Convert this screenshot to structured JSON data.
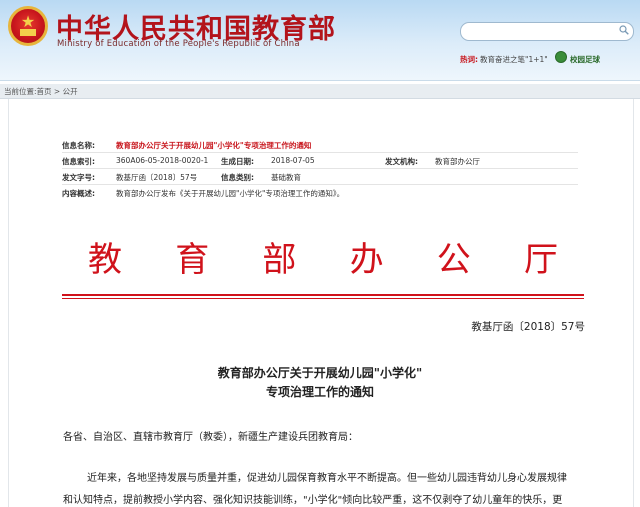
{
  "header": {
    "site_title": "中华人民共和国教育部",
    "site_subtitle": "Ministry of Education of the People's Republic of China",
    "hot_label": "热词:",
    "hot_link": "教育奋进之笔\"1+1\"",
    "campus_link": "校园足球"
  },
  "breadcrumb": {
    "prefix": "当前位置:",
    "home": "首页",
    "sep": " > ",
    "current": "公开"
  },
  "info": {
    "name_label": "信息名称:",
    "name_value": "教育部办公厅关于开展幼儿园\"小学化\"专项治理工作的通知",
    "index_label": "信息索引:",
    "index_value": "360A06-05-2018-0020-1",
    "date_label": "生成日期:",
    "date_value": "2018-07-05",
    "issuer_label": "发文机构:",
    "issuer_value": "教育部办公厅",
    "docno_label": "发文字号:",
    "docno_value": "教基厅函〔2018〕57号",
    "category_label": "信息类别:",
    "category_value": "基础教育",
    "summary_label": "内容概述:",
    "summary_value": "教育部办公厅发布《关于开展幼儿园\"小学化\"专项治理工作的通知》。"
  },
  "document": {
    "red_header": [
      "教",
      "育",
      "部",
      "办",
      "公",
      "厅"
    ],
    "number": "教基厅函〔2018〕57号",
    "title_line1": "教育部办公厅关于开展幼儿园\"小学化\"",
    "title_line2": "专项治理工作的通知",
    "salutation": "各省、自治区、直辖市教育厅（教委），新疆生产建设兵团教育局：",
    "para1_line1": "近年来，各地坚持发展与质量并重，促进幼儿园保育教育水平不断提高。但一些幼儿园违背幼儿身心发展规律",
    "para1_line2": "和认知特点，提前教授小学内容、强化知识技能训练，\"小学化\"倾向比较严重，这不仅剥夺了幼儿童年的快乐，更"
  },
  "colors": {
    "brand_red": "#d0121b",
    "header_blue": "#b9d9f3"
  }
}
